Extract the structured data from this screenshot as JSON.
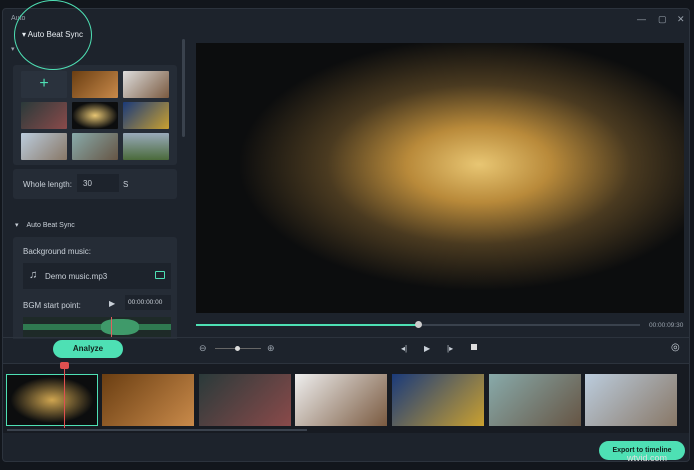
{
  "window": {
    "title": "Auto Beat Sync",
    "controls": [
      "minimize-icon",
      "maximize-icon",
      "close-icon"
    ]
  },
  "highlight": {
    "label": "Auto Beat Sync"
  },
  "media": {
    "add_label": "+",
    "whole_length_label": "Whole length:",
    "whole_length_value": "30",
    "unit": "S"
  },
  "beat": {
    "section_title": "Auto Beat Sync",
    "bgm_label": "Background music:",
    "music_file": "Demo music.mp3",
    "start_label": "BGM start point:",
    "start_time": "00:00:00:00"
  },
  "analyze_label": "Analyze",
  "player": {
    "duration": "00:00:09:30",
    "progress": 0.5,
    "zoom_level": 0.4
  },
  "export_label": "Export to timeline",
  "watermark": "wtvid.com",
  "accent": "#4ee0b4"
}
